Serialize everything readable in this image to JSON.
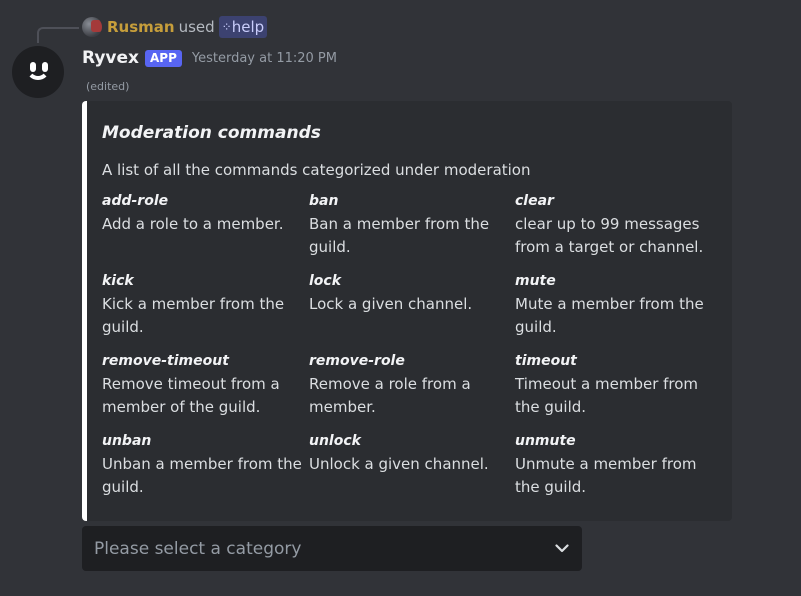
{
  "reply": {
    "username": "Rusman",
    "used_text": "used",
    "command": "help",
    "command_icon": "app-command-icon"
  },
  "message": {
    "author": "Ryvex",
    "tag": "APP",
    "timestamp": "Yesterday at 11:20 PM",
    "edited": "(edited)"
  },
  "embed": {
    "title": "Moderation commands",
    "description": "A list of all the commands categorized under moderation",
    "border_color": "#ffffff",
    "fields": [
      {
        "name": "add-role",
        "value": "Add a role to a member."
      },
      {
        "name": "ban",
        "value": "Ban a member from the guild."
      },
      {
        "name": "clear",
        "value": "clear up to 99 messages from a target or channel."
      },
      {
        "name": "kick",
        "value": "Kick a member from the guild."
      },
      {
        "name": "lock",
        "value": "Lock a given channel."
      },
      {
        "name": "mute",
        "value": "Mute a member from the guild."
      },
      {
        "name": "remove-timeout",
        "value": "Remove timeout from a member of the guild."
      },
      {
        "name": "remove-role",
        "value": "Remove a role from a member."
      },
      {
        "name": "timeout",
        "value": "Timeout a member from the guild."
      },
      {
        "name": "unban",
        "value": "Unban a member from the guild."
      },
      {
        "name": "unlock",
        "value": "Unlock a given channel."
      },
      {
        "name": "unmute",
        "value": "Unmute a member from the guild."
      }
    ]
  },
  "select_menu": {
    "placeholder": "Please select a category",
    "icon": "chevron-down-icon"
  },
  "colors": {
    "background": "#313338",
    "embed_background": "#2b2d31",
    "app_tag": "#5865f2",
    "reply_username": "#c69e3b"
  }
}
